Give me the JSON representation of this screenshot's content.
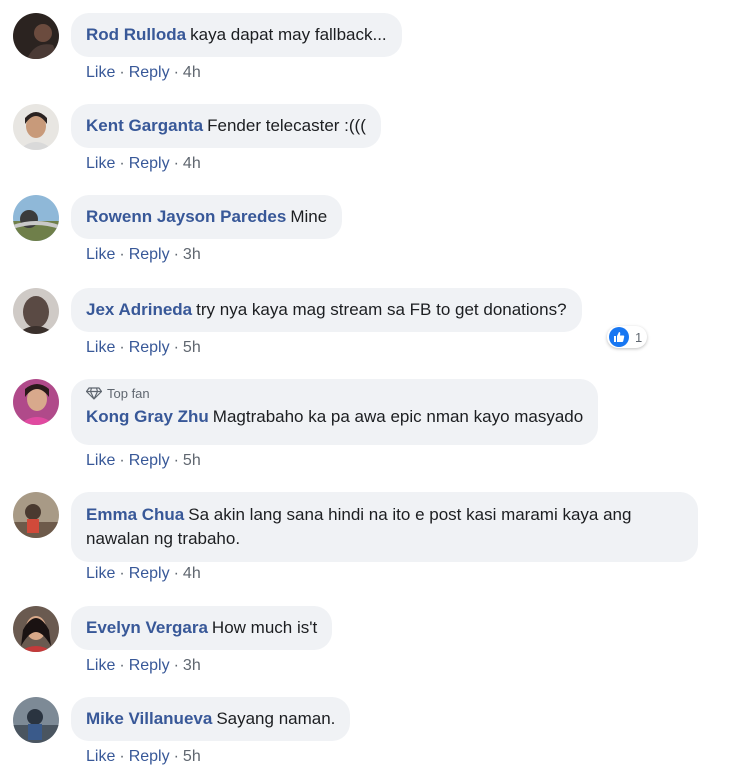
{
  "actions": {
    "like_label": "Like",
    "reply_label": "Reply",
    "separator": "·"
  },
  "comments": [
    {
      "author": "Rod Rulloda",
      "text": "kaya dapat may fallback...",
      "time": "4h"
    },
    {
      "author": "Kent Garganta",
      "text": "Fender telecaster :(((",
      "time": "4h"
    },
    {
      "author": "Rowenn Jayson Paredes",
      "text": "Mine",
      "time": "3h"
    },
    {
      "author": "Jex Adrineda",
      "text": "try nya kaya mag stream sa FB to get donations?",
      "time": "5h",
      "reaction_count": "1",
      "reaction_icon": "like-icon"
    },
    {
      "badge": "Top fan",
      "badge_icon": "diamond-icon",
      "author": "Kong Gray Zhu",
      "text": "Magtrabaho ka pa awa epic nman kayo masyado",
      "time": "5h"
    },
    {
      "author": "Emma Chua",
      "text": "Sa akin lang sana hindi na ito e post kasi marami kaya ang nawalan ng trabaho.",
      "time": "4h"
    },
    {
      "author": "Evelyn Vergara",
      "text": "How much is't",
      "time": "3h"
    },
    {
      "author": "Mike Villanueva",
      "text": "Sayang naman.",
      "time": "5h"
    }
  ],
  "colors": {
    "author": "#385898",
    "bubble": "#f0f2f5",
    "meta": "#606770",
    "like_blue": "#1877f2"
  }
}
